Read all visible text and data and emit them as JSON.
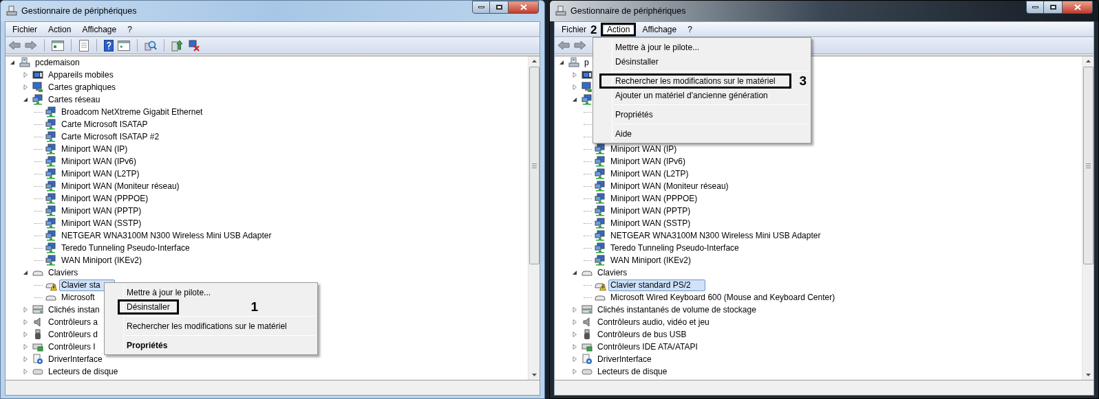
{
  "windows": [
    {
      "title": "Gestionnaire de périphériques",
      "active": true,
      "menu": [
        {
          "label": "Fichier",
          "selected": false,
          "outlined": false
        },
        {
          "label": "Action",
          "selected": false,
          "outlined": false
        },
        {
          "label": "Affichage",
          "selected": false,
          "outlined": false
        },
        {
          "label": "?",
          "selected": false,
          "outlined": false
        }
      ],
      "toolbar": [
        {
          "kind": "back"
        },
        {
          "kind": "forward"
        },
        {
          "kind": "sep"
        },
        {
          "kind": "tree"
        },
        {
          "kind": "sep"
        },
        {
          "kind": "props"
        },
        {
          "kind": "sep"
        },
        {
          "kind": "help"
        },
        {
          "kind": "pane"
        },
        {
          "kind": "sep"
        },
        {
          "kind": "scan"
        },
        {
          "kind": "sep"
        },
        {
          "kind": "update"
        },
        {
          "kind": "remove"
        }
      ],
      "tree": {
        "label": "pcdemaison",
        "kind": "computer",
        "expanded": true,
        "selected": false,
        "children": [
          {
            "label": "Appareils mobiles",
            "kind": "mobile",
            "expanded": false,
            "selected": false
          },
          {
            "label": "Cartes graphiques",
            "kind": "display",
            "expanded": false,
            "selected": false
          },
          {
            "label": "Cartes réseau",
            "kind": "network",
            "expanded": true,
            "selected": false,
            "children": [
              {
                "label": "Broadcom NetXtreme Gigabit Ethernet",
                "kind": "network",
                "selected": false
              },
              {
                "label": "Carte Microsoft ISATAP",
                "kind": "network",
                "selected": false
              },
              {
                "label": "Carte Microsoft ISATAP #2",
                "kind": "network",
                "selected": false
              },
              {
                "label": "Miniport WAN (IP)",
                "kind": "network",
                "selected": false
              },
              {
                "label": "Miniport WAN (IPv6)",
                "kind": "network",
                "selected": false
              },
              {
                "label": "Miniport WAN (L2TP)",
                "kind": "network",
                "selected": false
              },
              {
                "label": "Miniport WAN (Moniteur réseau)",
                "kind": "network",
                "selected": false
              },
              {
                "label": "Miniport WAN (PPPOE)",
                "kind": "network",
                "selected": false
              },
              {
                "label": "Miniport WAN (PPTP)",
                "kind": "network",
                "selected": false
              },
              {
                "label": "Miniport WAN (SSTP)",
                "kind": "network",
                "selected": false
              },
              {
                "label": "NETGEAR WNA3100M N300 Wireless Mini USB Adapter",
                "kind": "network",
                "selected": false
              },
              {
                "label": "Teredo Tunneling Pseudo-Interface",
                "kind": "network",
                "selected": false
              },
              {
                "label": "WAN Miniport (IKEv2)",
                "kind": "network",
                "selected": false
              }
            ]
          },
          {
            "label": "Claviers",
            "kind": "keyboard",
            "expanded": true,
            "selected": false,
            "children": [
              {
                "label": "Clavier sta",
                "kind": "keyboard",
                "selected": true,
                "warning": true
              },
              {
                "label": "Microsoft",
                "kind": "keyboard",
                "selected": false,
                "warning": false
              }
            ]
          },
          {
            "label": "Clichés instan",
            "kind": "storage",
            "expanded": false,
            "selected": false
          },
          {
            "label": "Contrôleurs a",
            "kind": "audio",
            "expanded": false,
            "selected": false
          },
          {
            "label": "Contrôleurs d",
            "kind": "usb",
            "expanded": false,
            "selected": false
          },
          {
            "label": "Contrôleurs I",
            "kind": "ide",
            "expanded": false,
            "selected": false
          },
          {
            "label": "DriverInterface",
            "kind": "driver",
            "expanded": false,
            "selected": false
          },
          {
            "label": "Lecteurs de disque",
            "kind": "disk",
            "expanded": false,
            "selected": false
          }
        ]
      },
      "popup": {
        "kind": "context",
        "items": [
          {
            "kind": "item",
            "label": "Mettre à jour le pilote...",
            "default": false,
            "outlined": false
          },
          {
            "kind": "item",
            "label": "Désinstaller",
            "default": false,
            "outlined": true,
            "callout": "1"
          },
          {
            "kind": "separator"
          },
          {
            "kind": "item",
            "label": "Rechercher les modifications sur le matériel",
            "default": false,
            "outlined": false
          },
          {
            "kind": "separator"
          },
          {
            "kind": "item",
            "label": "Propriétés",
            "default": true,
            "outlined": false
          }
        ]
      }
    },
    {
      "title": "Gestionnaire de périphériques",
      "active": false,
      "menu": [
        {
          "label": "Fichier",
          "selected": false,
          "outlined": false
        },
        {
          "label": "Action",
          "selected": true,
          "outlined": true,
          "callout": "2"
        },
        {
          "label": "Affichage",
          "selected": false,
          "outlined": false
        },
        {
          "label": "?",
          "selected": false,
          "outlined": false
        }
      ],
      "toolbar": [
        {
          "kind": "back"
        },
        {
          "kind": "forward"
        }
      ],
      "tree": {
        "label": "p",
        "kind": "computer",
        "expanded": true,
        "selected": false,
        "children": [
          {
            "kind": "mobile",
            "expanded": false
          },
          {
            "kind": "display",
            "expanded": false
          },
          {
            "kind": "network",
            "expanded": true,
            "children": [
              {
                "kind": "stub"
              },
              {
                "kind": "stub"
              },
              {
                "kind": "stub"
              },
              {
                "label": "Miniport WAN (IP)",
                "kind": "network",
                "selected": false
              },
              {
                "label": "Miniport WAN (IPv6)",
                "kind": "network",
                "selected": false
              },
              {
                "label": "Miniport WAN (L2TP)",
                "kind": "network",
                "selected": false
              },
              {
                "label": "Miniport WAN (Moniteur réseau)",
                "kind": "network",
                "selected": false
              },
              {
                "label": "Miniport WAN (PPPOE)",
                "kind": "network",
                "selected": false
              },
              {
                "label": "Miniport WAN (PPTP)",
                "kind": "network",
                "selected": false
              },
              {
                "label": "Miniport WAN (SSTP)",
                "kind": "network",
                "selected": false
              },
              {
                "label": "NETGEAR WNA3100M N300 Wireless Mini USB Adapter",
                "kind": "network",
                "selected": false
              },
              {
                "label": "Teredo Tunneling Pseudo-Interface",
                "kind": "network",
                "selected": false
              },
              {
                "label": "WAN Miniport (IKEv2)",
                "kind": "network",
                "selected": false
              }
            ]
          },
          {
            "label": "Claviers",
            "kind": "keyboard",
            "expanded": true,
            "selected": false,
            "children": [
              {
                "label": "Clavier standard PS/2",
                "kind": "keyboard",
                "selected": true,
                "warning": true
              },
              {
                "label": "Microsoft Wired Keyboard 600 (Mouse and Keyboard Center)",
                "kind": "keyboard",
                "selected": false,
                "warning": false
              }
            ]
          },
          {
            "label": "Clichés instantanés de volume de stockage",
            "kind": "storage",
            "expanded": false,
            "selected": false
          },
          {
            "label": "Contrôleurs audio, vidéo et jeu",
            "kind": "audio",
            "expanded": false,
            "selected": false
          },
          {
            "label": "Contrôleurs de bus USB",
            "kind": "usb",
            "expanded": false,
            "selected": false
          },
          {
            "label": "Contrôleurs IDE ATA/ATAPI",
            "kind": "ide",
            "expanded": false,
            "selected": false
          },
          {
            "label": "DriverInterface",
            "kind": "driver",
            "expanded": false,
            "selected": false
          },
          {
            "label": "Lecteurs de disque",
            "kind": "disk",
            "expanded": false,
            "selected": false
          }
        ]
      },
      "popup": {
        "kind": "dropdown",
        "items": [
          {
            "kind": "item",
            "label": "Mettre à jour le pilote...",
            "default": false,
            "outlined": false
          },
          {
            "kind": "item",
            "label": "Désinstaller",
            "default": false,
            "outlined": false
          },
          {
            "kind": "separator"
          },
          {
            "kind": "item",
            "label": "Rechercher les modifications sur le matériel",
            "default": false,
            "outlined": true,
            "callout": "3"
          },
          {
            "kind": "item",
            "label": "Ajouter un matériel d'ancienne génération",
            "default": false,
            "outlined": false
          },
          {
            "kind": "separator"
          },
          {
            "kind": "item",
            "label": "Propriétés",
            "default": false,
            "outlined": false
          },
          {
            "kind": "separator"
          },
          {
            "kind": "item",
            "label": "Aide",
            "default": false,
            "outlined": false
          }
        ]
      }
    }
  ]
}
